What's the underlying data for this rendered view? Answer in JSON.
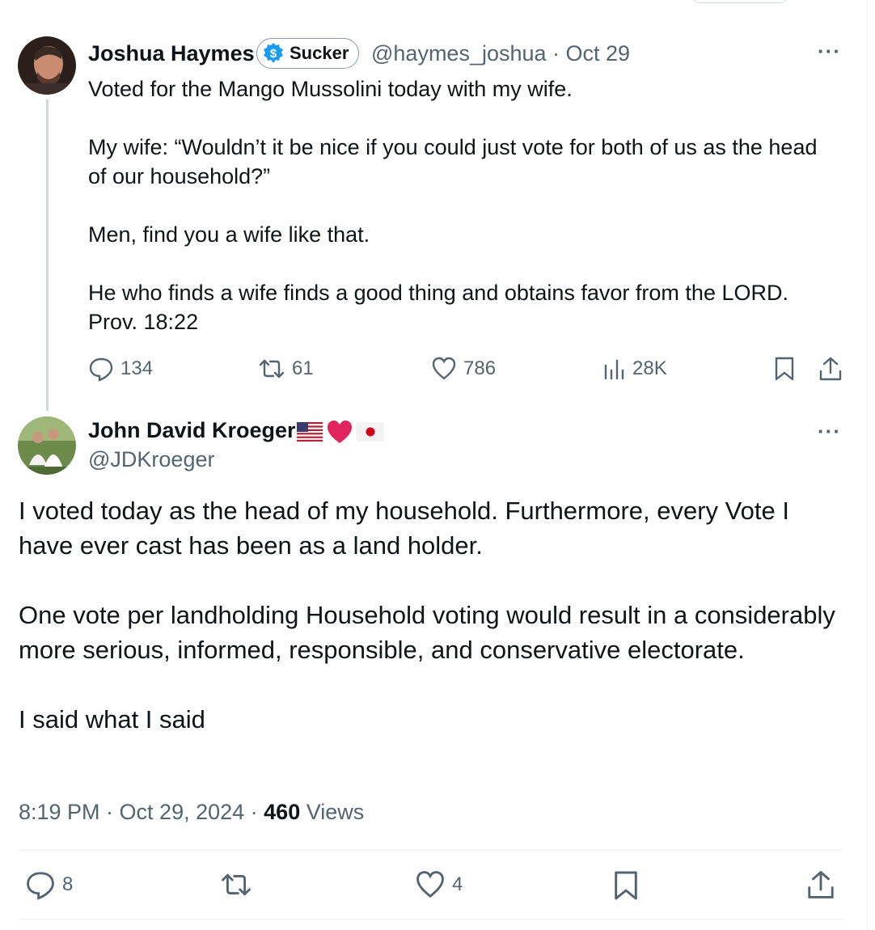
{
  "tweet1": {
    "author_name": "Joshua Haymes",
    "badge_label": "Sucker",
    "handle_time": "@haymes_joshua · Oct 29",
    "paragraphs": [
      "Voted for the Mango Mussolini today with my wife.",
      "My wife: “Wouldn’t it be nice if you could just vote for both of us as the head of our household?”",
      "Men, find you a wife like that.",
      "He who finds a wife finds a good thing and obtains favor from the LORD. Prov. 18:22"
    ],
    "replies": "134",
    "reposts": "61",
    "likes": "786",
    "views": "28K"
  },
  "tweet2": {
    "author_name": "John David Kroeger",
    "handle": "@JDKroeger",
    "paragraphs": [
      "I voted today as the head of my household. Furthermore, every Vote I have ever cast has been as a land holder.",
      "One vote per landholding Household voting would result in a considerably more serious, informed, responsible, and conservative electorate.",
      "I said what I said"
    ],
    "time_date": "8:19 PM · Oct 29, 2024 · ",
    "views_count": "460",
    "views_label": " Views",
    "replies": "8",
    "likes": "4"
  },
  "icons": {
    "more": "more-icon",
    "reply": "reply-icon",
    "repost": "repost-icon",
    "like": "like-icon",
    "views": "views-icon",
    "bookmark": "bookmark-icon",
    "share": "share-icon"
  },
  "colors": {
    "text": "#0f1419",
    "muted": "#536471",
    "badge_blue": "#1d9bf0",
    "heart_red": "#e0245e"
  }
}
